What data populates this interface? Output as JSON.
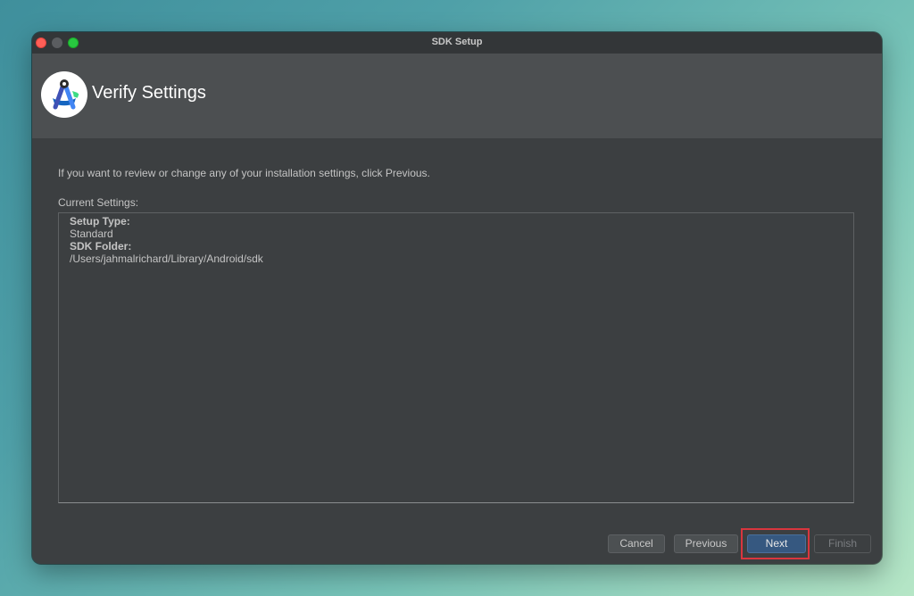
{
  "window": {
    "title": "SDK Setup"
  },
  "header": {
    "title": "Verify Settings",
    "logo_icon": "android-studio-logo-icon"
  },
  "main": {
    "instruction": "If you want to review or change any of your installation settings, click Previous.",
    "settings_label": "Current Settings:",
    "settings": [
      {
        "key": "Setup Type:",
        "value": "Standard"
      },
      {
        "key": "SDK Folder:",
        "value": "/Users/jahmalrichard/Library/Android/sdk"
      }
    ]
  },
  "footer": {
    "cancel_label": "Cancel",
    "previous_label": "Previous",
    "next_label": "Next",
    "finish_label": "Finish"
  },
  "colors": {
    "accent": "#365880",
    "highlight": "#d9363e",
    "window_bg": "#3c3f41",
    "header_bg": "#4c4f51"
  }
}
